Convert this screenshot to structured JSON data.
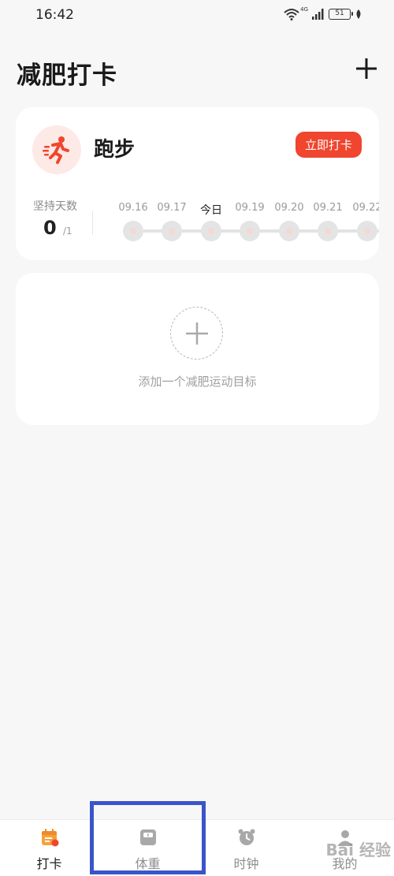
{
  "status_bar": {
    "time": "16:42",
    "network": "4G",
    "battery": "51"
  },
  "header": {
    "title": "减肥打卡"
  },
  "run_card": {
    "title": "跑步",
    "checkin_label": "立即打卡",
    "streak_label": "坚持天数",
    "streak_value": "0",
    "streak_goal": "/1",
    "days": [
      "09.16",
      "09.17",
      "今日",
      "09.19",
      "09.20",
      "09.21",
      "09.22"
    ]
  },
  "add_card": {
    "text": "添加一个减肥运动目标"
  },
  "bottom_nav": {
    "items": [
      {
        "label": "打卡",
        "active": true
      },
      {
        "label": "体重",
        "active": false
      },
      {
        "label": "时钟",
        "active": false
      },
      {
        "label": "我的",
        "active": false
      }
    ]
  },
  "watermark": "Bai 经验",
  "colors": {
    "accent": "#f0452e",
    "highlight": "#3a55c9"
  }
}
